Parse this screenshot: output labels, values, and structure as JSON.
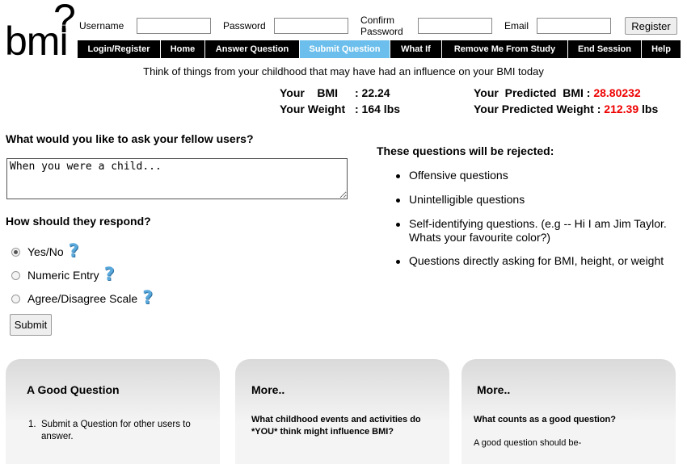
{
  "logo": {
    "text": "bmi",
    "mark": "?"
  },
  "auth": {
    "username_label": "Username",
    "password_label": "Password",
    "confirm_label_line1": "Confirm",
    "confirm_label_line2": "Password",
    "email_label": "Email",
    "register_label": "Register"
  },
  "nav": [
    "Login/Register",
    "Home",
    "Answer Question",
    "Submit Question",
    "What If",
    "Remove Me From Study",
    "End Session",
    "Help"
  ],
  "nav_active": "Submit Question",
  "tagline": "Think of things from your childhood that may have had an influence on your BMI today",
  "stats": {
    "bmi_label": "Your    BMI",
    "bmi_sep": ": 22.24",
    "weight_label": "Your Weight",
    "weight_sep": ": 164 lbs",
    "pred_bmi_label": "Your  Predicted  BMI",
    "pred_bmi_colon": " : ",
    "pred_bmi_value": "28.80232",
    "pred_weight_label": "Your Predicted Weight",
    "pred_weight_colon": " : ",
    "pred_weight_value": "212.39",
    "pred_weight_unit": " lbs"
  },
  "form": {
    "ask_heading": "What would you like to ask your fellow users?",
    "question_value": "When you were a child...",
    "respond_heading": "How should they respond?",
    "options": [
      "Yes/No",
      "Numeric Entry",
      "Agree/Disagree Scale"
    ],
    "selected": "Yes/No",
    "submit_label": "Submit"
  },
  "rejected": {
    "heading": "These questions will be rejected:",
    "rules": [
      "Offensive questions",
      "Unintelligible questions",
      "Self-identifying questions. (e.g -- Hi I am Jim Taylor. Whats your favourite color?)",
      "Questions directly asking for BMI, height, or weight"
    ]
  },
  "panels": {
    "good_title": "A Good Question",
    "good_item": "Submit a Question for other users to answer.",
    "more1_title": "More..",
    "more1_sub": "What childhood events and activities do *YOU* think might influence BMI?",
    "more2_title": "More..",
    "more2_sub": "What counts as a good question?",
    "more2_text": "A good question should be-"
  },
  "colors": {
    "nav_bg": "#000000",
    "nav_active": "#6cbfec",
    "highlight_red": "#e00000",
    "help_icon": "#5aa9dc"
  }
}
